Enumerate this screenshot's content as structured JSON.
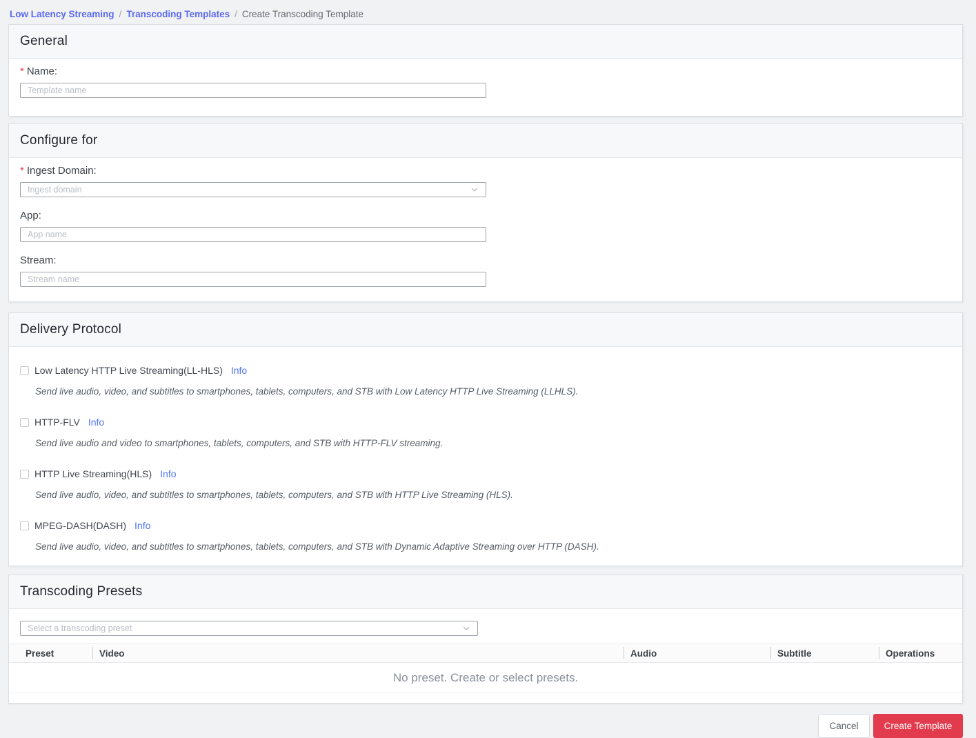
{
  "colors": {
    "link_blue": "#5a68f1",
    "info_blue": "#4d74f4",
    "danger_red": "#e23b4e",
    "page_bg": "#f1f2f4",
    "card_bg": "#ffffff"
  },
  "breadcrumb": {
    "separator": "/",
    "items": [
      {
        "label": "Low Latency Streaming",
        "type": "link"
      },
      {
        "label": "Transcoding Templates",
        "type": "link"
      },
      {
        "label": "Create Transcoding Template",
        "type": "current"
      }
    ]
  },
  "general": {
    "title": "General",
    "required_mark": "*",
    "name_label": "Name:",
    "name_placeholder": "Template name"
  },
  "configure": {
    "title": "Configure for",
    "required_mark": "*",
    "ingest_label": "Ingest Domain:",
    "ingest_placeholder": "Ingest domain",
    "app_label": "App:",
    "app_placeholder": "App name",
    "stream_label": "Stream:",
    "stream_placeholder": "Stream name"
  },
  "delivery": {
    "title": "Delivery Protocol",
    "protocols": [
      {
        "label": "Low Latency HTTP Live Streaming(LL-HLS)",
        "info": "Info",
        "checked": false,
        "description": "Send live audio, video, and subtitles to smartphones, tablets, computers, and STB with Low Latency HTTP Live Streaming (LLHLS)."
      },
      {
        "label": "HTTP-FLV",
        "info": "Info",
        "checked": false,
        "description": "Send live audio and video to smartphones, tablets, computers, and STB with HTTP-FLV streaming."
      },
      {
        "label": "HTTP Live Streaming(HLS)",
        "info": "Info",
        "checked": false,
        "description": "Send live audio, video, and subtitles to smartphones, tablets, computers, and STB with HTTP Live Streaming (HLS)."
      },
      {
        "label": "MPEG-DASH(DASH)",
        "info": "Info",
        "checked": false,
        "description": "Send live audio, video, and subtitles to smartphones, tablets, computers, and STB with Dynamic Adaptive Streaming over HTTP (DASH)."
      }
    ]
  },
  "presets": {
    "title": "Transcoding Presets",
    "select_placeholder": "Select a transcoding preset",
    "table": {
      "columns": [
        "Preset",
        "Video",
        "Audio",
        "Subtitle",
        "Operations"
      ],
      "rows": [],
      "empty_text": "No preset. Create or select presets."
    }
  },
  "footer": {
    "cancel_label": "Cancel",
    "submit_label": "Create Template"
  }
}
